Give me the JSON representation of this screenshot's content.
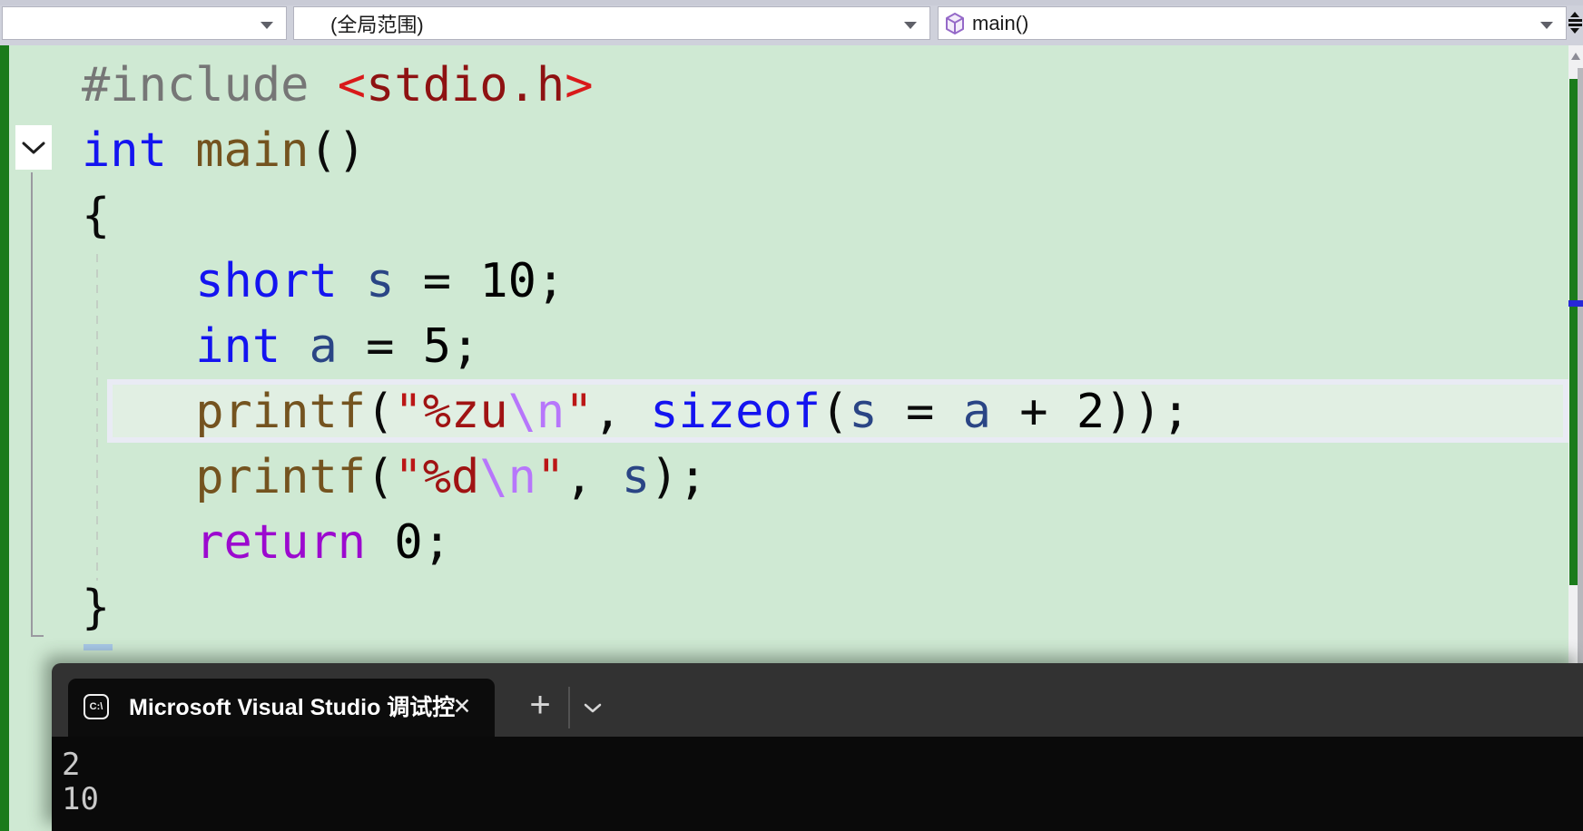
{
  "topbar": {
    "combo_left_value": "",
    "combo_scope_value": "(全局范围)",
    "combo_member_value": "main()"
  },
  "editor": {
    "language": "c",
    "lines": [
      [
        [
          "dir",
          "#include "
        ],
        [
          "incb",
          "<"
        ],
        [
          "inc",
          "stdio.h"
        ],
        [
          "incb",
          ">"
        ]
      ],
      [
        [
          "kw",
          "int"
        ],
        [
          "pl",
          " "
        ],
        [
          "fn",
          "main"
        ],
        [
          "pl",
          "()"
        ]
      ],
      [
        [
          "pl",
          "{"
        ]
      ],
      [
        [
          "pl",
          "    "
        ],
        [
          "kw",
          "short"
        ],
        [
          "pl",
          " "
        ],
        [
          "var",
          "s"
        ],
        [
          "pl",
          " = "
        ],
        [
          "num",
          "10"
        ],
        [
          "pl",
          ";"
        ]
      ],
      [
        [
          "pl",
          "    "
        ],
        [
          "kw",
          "int"
        ],
        [
          "pl",
          " "
        ],
        [
          "var",
          "a"
        ],
        [
          "pl",
          " = "
        ],
        [
          "num",
          "5"
        ],
        [
          "pl",
          ";"
        ]
      ],
      [
        [
          "pl",
          "    "
        ],
        [
          "fn",
          "printf"
        ],
        [
          "pl",
          "("
        ],
        [
          "str",
          "\""
        ],
        [
          "fmt",
          "%zu"
        ],
        [
          "esc",
          "\\n"
        ],
        [
          "str",
          "\""
        ],
        [
          "pl",
          ", "
        ],
        [
          "kw",
          "sizeof"
        ],
        [
          "pl",
          "("
        ],
        [
          "var",
          "s"
        ],
        [
          "pl",
          " = "
        ],
        [
          "var",
          "a"
        ],
        [
          "pl",
          " + "
        ],
        [
          "num",
          "2"
        ],
        [
          "pl",
          "));"
        ]
      ],
      [
        [
          "pl",
          "    "
        ],
        [
          "fn",
          "printf"
        ],
        [
          "pl",
          "("
        ],
        [
          "str",
          "\""
        ],
        [
          "fmt",
          "%d"
        ],
        [
          "esc",
          "\\n"
        ],
        [
          "str",
          "\""
        ],
        [
          "pl",
          ", "
        ],
        [
          "var",
          "s"
        ],
        [
          "pl",
          ");"
        ]
      ],
      [
        [
          "pl",
          "    "
        ],
        [
          "ctrl",
          "return"
        ],
        [
          "pl",
          " "
        ],
        [
          "num",
          "0"
        ],
        [
          "pl",
          ";"
        ]
      ],
      [
        [
          "pl",
          "}"
        ]
      ]
    ],
    "current_line_number": 6
  },
  "terminal": {
    "tab_title": "Microsoft Visual Studio 调试控",
    "tab_icon_text": "C:\\",
    "close_label": "✕",
    "new_tab_label": "+",
    "output": [
      "2",
      "10"
    ]
  },
  "colors": {
    "editor_background": "#cfe9d3",
    "changed_lines_green": "#1b7b1b",
    "current_line_fill": "#e1efe3",
    "current_line_border": "#e9ebf4",
    "scroll_caret_blue": "#2727d8",
    "terminal_tabbar": "#323232",
    "terminal_background": "#0a0a0a",
    "cube_icon_purple": "#9569c8"
  }
}
